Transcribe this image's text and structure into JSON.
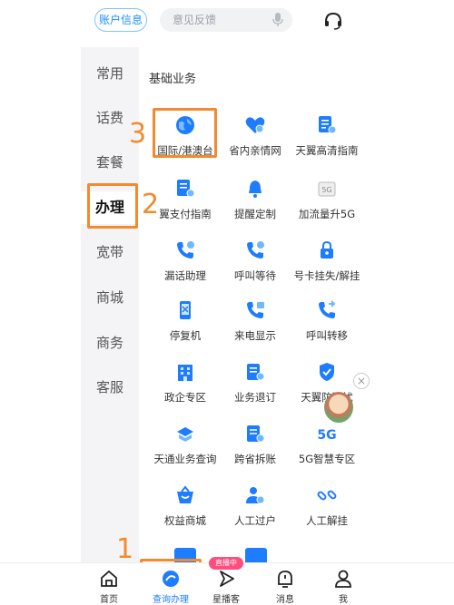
{
  "topbar": {
    "account_label": "账户信息",
    "search_placeholder": "意见反馈"
  },
  "sidebar": {
    "items": [
      {
        "label": "常用"
      },
      {
        "label": "话费"
      },
      {
        "label": "套餐"
      },
      {
        "label": "办理",
        "active": true
      },
      {
        "label": "宽带"
      },
      {
        "label": "商城"
      },
      {
        "label": "商务"
      },
      {
        "label": "客服"
      }
    ]
  },
  "section": {
    "title": "基础业务"
  },
  "services": [
    {
      "label": "国际/港澳台",
      "icon": "globe-icon"
    },
    {
      "label": "省内亲情网",
      "icon": "heart-network-icon"
    },
    {
      "label": "天翼高清指南",
      "icon": "document-icon"
    },
    {
      "label": "翼支付指南",
      "icon": "payment-guide-icon"
    },
    {
      "label": "提醒定制",
      "icon": "bell-icon"
    },
    {
      "label": "加流量升5G",
      "icon": "5g-upgrade-icon"
    },
    {
      "label": "漏话助理",
      "icon": "phone-missed-icon"
    },
    {
      "label": "呼叫等待",
      "icon": "phone-wait-icon"
    },
    {
      "label": "号卡挂失/解挂",
      "icon": "sim-lock-icon"
    },
    {
      "label": "停复机",
      "icon": "mobile-phone-icon"
    },
    {
      "label": "来电显示",
      "icon": "caller-id-icon"
    },
    {
      "label": "呼叫转移",
      "icon": "call-forward-icon"
    },
    {
      "label": "政企专区",
      "icon": "building-icon"
    },
    {
      "label": "业务退订",
      "icon": "unsubscribe-icon"
    },
    {
      "label": "天翼防骚扰",
      "icon": "anti-harass-icon"
    },
    {
      "label": "天通业务查询",
      "icon": "satellite-icon"
    },
    {
      "label": "跨省拆账",
      "icon": "split-bill-icon"
    },
    {
      "label": "5G智慧专区",
      "icon": "5g-icon"
    },
    {
      "label": "权益商城",
      "icon": "shop-bag-icon"
    },
    {
      "label": "人工过户",
      "icon": "transfer-user-icon"
    },
    {
      "label": "人工解挂",
      "icon": "unlink-icon"
    }
  ],
  "annotations": [
    "1",
    "2",
    "3"
  ],
  "live_badge": "直播中",
  "bottom_nav": [
    {
      "label": "首页",
      "icon": "home-icon"
    },
    {
      "label": "查询办理",
      "icon": "query-icon",
      "active": true
    },
    {
      "label": "星播客",
      "icon": "play-icon"
    },
    {
      "label": "消息",
      "icon": "message-icon"
    },
    {
      "label": "我",
      "icon": "user-icon"
    }
  ],
  "colors": {
    "primary": "#1e7cff",
    "annotation": "#f28a2e"
  }
}
